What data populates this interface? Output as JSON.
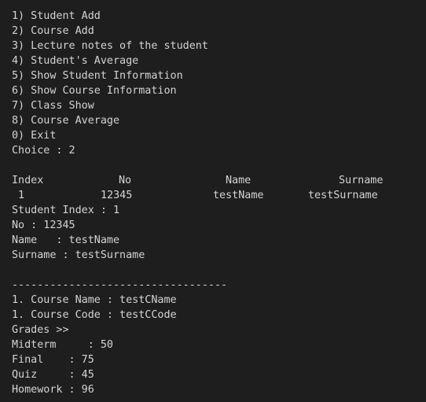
{
  "menu": [
    "1) Student Add",
    "2) Course Add",
    "3) Lecture notes of the student",
    "4) Student's Average",
    "5) Show Student Information",
    "6) Show Course Information",
    "7) Class Show",
    "8) Course Average",
    "0) Exit"
  ],
  "prompt": "Choice : 2",
  "table": {
    "headers": [
      "Index",
      "No",
      "Name",
      "Surname"
    ],
    "row": [
      "1",
      "12345",
      "testName",
      "testSurname"
    ]
  },
  "student": {
    "index_line": "Student Index : 1",
    "no_line": "No : 12345",
    "name_line": "Name   : testName",
    "surname_line": "Surname : testSurname"
  },
  "separator": "----------------------------------",
  "course": {
    "name_line": "1. Course Name : testCName",
    "code_line": "1. Course Code : testCCode"
  },
  "grades": {
    "title": "Grades >>",
    "midterm": "Midterm     : 50",
    "final": "Final    : 75",
    "quiz": "Quiz     : 45",
    "homework": "Homework : 96"
  },
  "colors": {
    "background": "#1e1e1e",
    "text": "#d4d4d4"
  }
}
